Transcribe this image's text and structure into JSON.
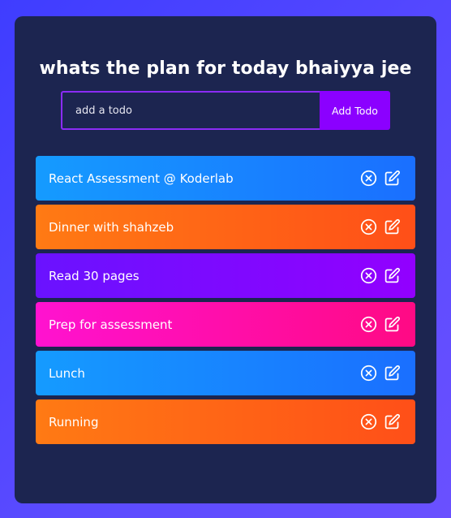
{
  "header": {
    "title": "whats the plan for today bhaiyya jee"
  },
  "form": {
    "input_placeholder": "add a todo",
    "input_value": "",
    "add_button_label": "Add Todo"
  },
  "todos": [
    {
      "text": "React Assessment @ Koderlab",
      "color": "blue"
    },
    {
      "text": "Dinner with shahzeb",
      "color": "orange"
    },
    {
      "text": "Read 30 pages",
      "color": "purple"
    },
    {
      "text": "Prep for assessment",
      "color": "pink"
    },
    {
      "text": "Lunch",
      "color": "blue"
    },
    {
      "text": "Running",
      "color": "orange"
    }
  ],
  "icons": {
    "delete": "close-circle-icon",
    "edit": "edit-icon"
  },
  "colors": {
    "page_background": "#4f46ff",
    "panel_background": "#1c2550",
    "accent": "#8b00ff",
    "blue": "#1a8cff",
    "orange": "#ff6416",
    "purple": "#8000ff",
    "pink": "#ff0ab0"
  }
}
